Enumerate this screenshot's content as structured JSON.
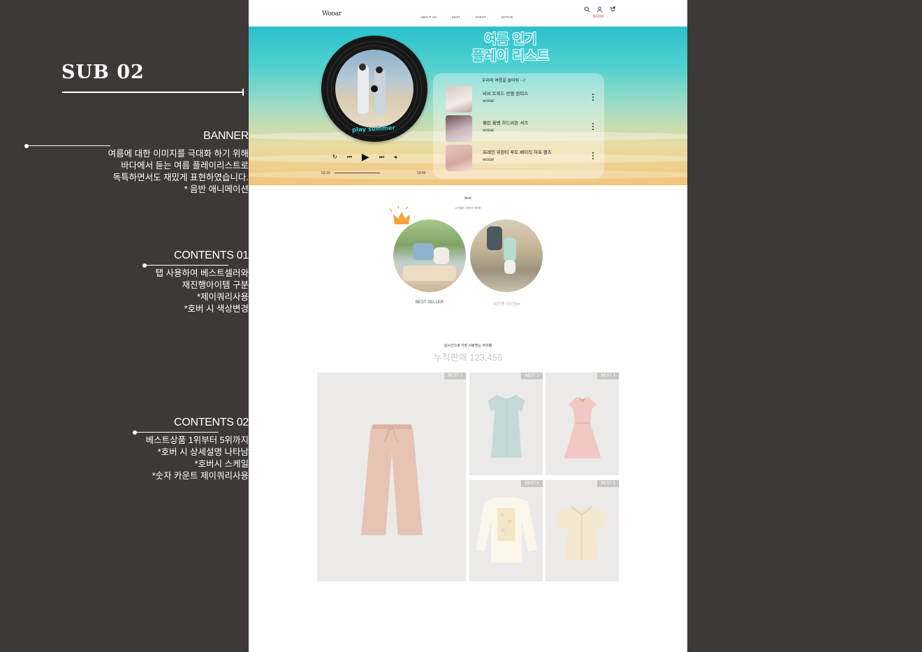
{
  "left_panel": {
    "title": "SUB 02",
    "sections": [
      {
        "heading": "BANNER",
        "lines": [
          "여름에 대한 이미지를 극대화 하기 위해",
          "바다에서 듣는 여름 플레이리스트로",
          "독특하면서도 재밌게 표현하였습니다.",
          "* 음반 애니메이션"
        ]
      },
      {
        "heading": "CONTENTS 01",
        "lines": [
          "탭 사용하여 베스트셀러와",
          "재진행아이템 구분",
          "*제이쿼리사용",
          "*호버 시 색상변경"
        ]
      },
      {
        "heading": "CONTENTS 02",
        "lines": [
          "베스트상품 1위부터 5위까지",
          "*호버 시 상세설명 나타남",
          "*호버시 스케일",
          "*숫자 카운트 제이쿼리사용"
        ]
      }
    ]
  },
  "site": {
    "logo": "Wooar",
    "menu": [
      "ABOUT US",
      "BEST",
      "EVENT",
      "NOTICE"
    ],
    "icons": [
      "search-icon",
      "user-icon",
      "cart-icon"
    ],
    "login_tag": "LOGIN",
    "banner": {
      "title_line1": "여름 인기",
      "title_line2": "플레이 리스트",
      "vinyl_caption": "play summer",
      "playlist_heading": "우리의 여름을 들어줘 ~♬",
      "tracks": [
        {
          "title": "비비 트위드 반팔 원피스",
          "artist": "wooar"
        },
        {
          "title": "웰린 올밴 하드비튼 셔즈",
          "artist": "wooar"
        },
        {
          "title": "프레인 위판티 루트 베이직 하프 팬츠",
          "artist": "wooar"
        }
      ],
      "time_current": "02:10",
      "time_total": "03:45"
    },
    "best_tabs": {
      "heading": "best",
      "subheading": "#우월의 로마러 피린♥",
      "tabs": [
        {
          "label": "BEST SELLER",
          "color": "#555555"
        },
        {
          "label": "재진행 아이템♥",
          "color": "#b8b8b8"
        }
      ]
    },
    "counter": {
      "subtitle": "실시간으로 가장 사랑받는 아이템",
      "text": "누적판매 123,456"
    },
    "products": [
      {
        "badge": "BEST 1"
      },
      {
        "badge": "BEST 2"
      },
      {
        "badge": "BEST 3"
      },
      {
        "badge": "BEST 4"
      },
      {
        "badge": "BEST 5"
      }
    ]
  }
}
